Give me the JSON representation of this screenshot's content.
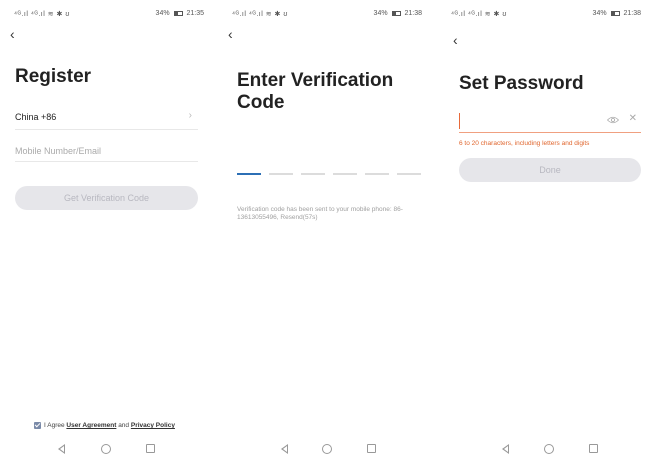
{
  "status": {
    "signal": "⁴ᴳ.ıl ⁴ᴳ.ıl ≋ ✱ ʊ",
    "screen1_right": "34%",
    "screen1_time": "21:35",
    "screen2_right": "34%",
    "screen2_time": "21:38",
    "screen3_right": "34%",
    "screen3_time": "21:38"
  },
  "register": {
    "back_glyph": "‹",
    "title": "Register",
    "country": "China +86",
    "mobile_placeholder": "Mobile Number/Email",
    "verify_button": "Get Verification Code",
    "agree_prefix": "I Agree ",
    "user_agreement": "User Agreement",
    "agree_and": " and ",
    "privacy_policy": "Privacy Policy"
  },
  "verification": {
    "back_glyph": "‹",
    "title_line1": "Enter Verification",
    "title_line2": "Code",
    "code_slots": 6,
    "active_slot": 0,
    "note": "Verification code has been sent to your mobile phone: 86-13613055496, Resend(57s)"
  },
  "password": {
    "back_glyph": "‹",
    "title": "Set Password",
    "input_value": "",
    "hint": "6 to 20 characters, including letters and digits",
    "done_button": "Done"
  },
  "icons": {
    "chevron_right": "›",
    "clear": "✕"
  },
  "colors": {
    "accent_orange": "#e0662e",
    "active_slot_blue": "#2c6fb5",
    "disabled_button_bg": "#e6e6ea",
    "disabled_button_text": "#b8b8c0"
  }
}
